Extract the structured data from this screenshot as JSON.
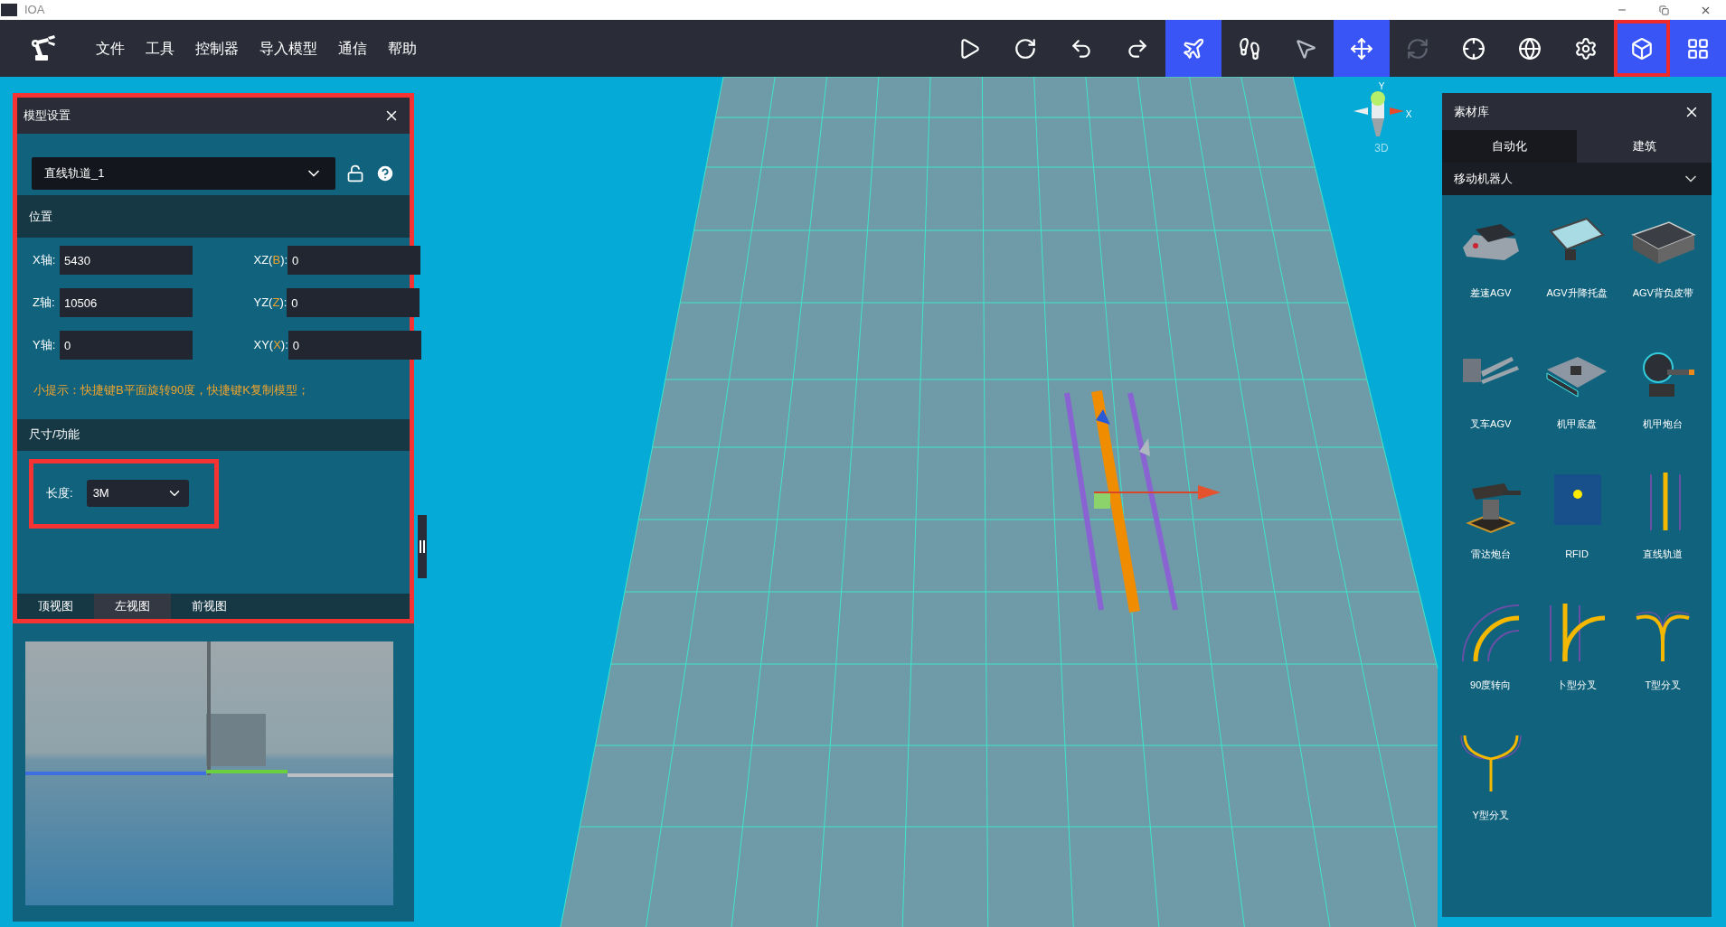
{
  "window": {
    "title": "IOA"
  },
  "menu": [
    "文件",
    "工具",
    "控制器",
    "导入模型",
    "通信",
    "帮助"
  ],
  "toolbar": [
    {
      "kind": "play",
      "selected": false,
      "disabled": false,
      "highlighted": false
    },
    {
      "kind": "rotate",
      "selected": false,
      "disabled": false,
      "highlighted": false
    },
    {
      "kind": "undo",
      "selected": false,
      "disabled": false,
      "highlighted": false
    },
    {
      "kind": "redo",
      "selected": false,
      "disabled": false,
      "highlighted": false
    },
    {
      "kind": "plane",
      "selected": true,
      "disabled": false,
      "highlighted": false
    },
    {
      "kind": "footprints",
      "selected": false,
      "disabled": false,
      "highlighted": false
    },
    {
      "kind": "pointer",
      "selected": false,
      "disabled": false,
      "highlighted": false
    },
    {
      "kind": "move",
      "selected": true,
      "disabled": false,
      "highlighted": false
    },
    {
      "kind": "refresh",
      "selected": false,
      "disabled": true,
      "highlighted": false
    },
    {
      "kind": "crosshair",
      "selected": false,
      "disabled": false,
      "highlighted": false
    },
    {
      "kind": "globe",
      "selected": false,
      "disabled": false,
      "highlighted": false
    },
    {
      "kind": "settings",
      "selected": false,
      "disabled": false,
      "highlighted": false
    },
    {
      "kind": "cube",
      "selected": true,
      "disabled": false,
      "highlighted": true
    },
    {
      "kind": "grid",
      "selected": true,
      "disabled": false,
      "highlighted": false
    }
  ],
  "model_panel": {
    "title": "模型设置",
    "highlighted": true,
    "model_select": "直线轨道_1",
    "position": {
      "title": "位置",
      "fields": [
        {
          "label_parts": [
            {
              "text": "X轴:",
              "highlight": false
            }
          ],
          "value": "5430"
        },
        {
          "label_parts": [
            {
              "text": "XZ(",
              "highlight": false
            },
            {
              "text": "B",
              "highlight": true
            },
            {
              "text": "):",
              "highlight": false
            }
          ],
          "value": "0"
        },
        {
          "label_parts": [
            {
              "text": "Z轴:",
              "highlight": false
            }
          ],
          "value": "10506"
        },
        {
          "label_parts": [
            {
              "text": "YZ(",
              "highlight": false
            },
            {
              "text": "Z",
              "highlight": true
            },
            {
              "text": "):",
              "highlight": false
            }
          ],
          "value": "0"
        },
        {
          "label_parts": [
            {
              "text": "Y轴:",
              "highlight": false
            }
          ],
          "value": "0"
        },
        {
          "label_parts": [
            {
              "text": "XY(",
              "highlight": false
            },
            {
              "text": "X",
              "highlight": true
            },
            {
              "text": "):",
              "highlight": false
            }
          ],
          "value": "0"
        }
      ],
      "tip": "小提示：快捷键B平面旋转90度，快捷键K复制模型；"
    },
    "size": {
      "title": "尺寸/功能",
      "length_label": "长度:",
      "length_value": "3M",
      "highlighted": true
    },
    "view_tabs": [
      {
        "label": "顶视图",
        "selected": false
      },
      {
        "label": "左视图",
        "selected": true
      },
      {
        "label": "前视图",
        "selected": false
      }
    ]
  },
  "gizmo": {
    "y_label": "Y",
    "x_label": "X",
    "mode": "3D"
  },
  "library": {
    "title": "素材库",
    "tabs": [
      {
        "label": "自动化",
        "selected": true
      },
      {
        "label": "建筑",
        "selected": false
      }
    ],
    "category": "移动机器人",
    "items": [
      {
        "label": "差速AGV",
        "kind": "agv"
      },
      {
        "label": "AGV升降托盘",
        "kind": "tray"
      },
      {
        "label": "AGV背负皮带",
        "kind": "belt"
      },
      {
        "label": "叉车AGV",
        "kind": "forklift"
      },
      {
        "label": "机甲底盘",
        "kind": "chassis"
      },
      {
        "label": "机甲炮台",
        "kind": "turret"
      },
      {
        "label": "雷达炮台",
        "kind": "radar"
      },
      {
        "label": "RFID",
        "kind": "rfid"
      },
      {
        "label": "直线轨道",
        "kind": "straight"
      },
      {
        "label": "90度转向",
        "kind": "curve"
      },
      {
        "label": "卜型分叉",
        "kind": "branch"
      },
      {
        "label": "T型分叉",
        "kind": "tee"
      },
      {
        "label": "Y型分叉",
        "kind": "wye"
      }
    ]
  }
}
